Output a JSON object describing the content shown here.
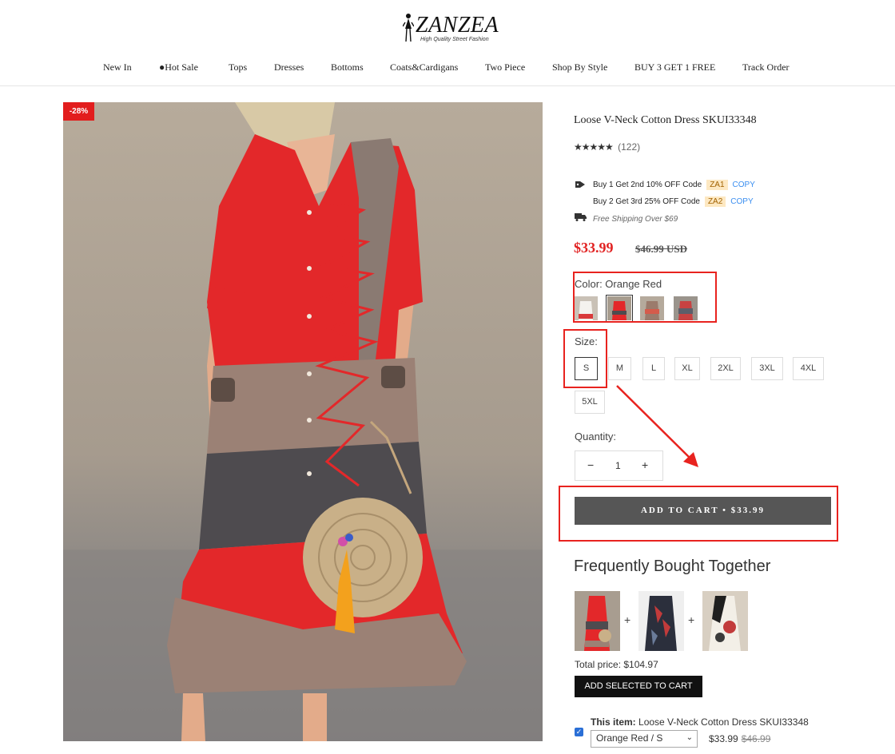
{
  "header": {
    "brand": "ZANZEA",
    "tagline": "High Quality Street Fashion",
    "nav": [
      "New In",
      "Hot Sale",
      "Tops",
      "Dresses",
      "Bottoms",
      "Coats&Cardigans",
      "Two Piece",
      "Shop By Style",
      "BUY 3 GET 1 FREE",
      "Track Order"
    ]
  },
  "product": {
    "discount_badge": "-28%",
    "title": "Loose V-Neck Cotton Dress SKUI33348",
    "stars": "★★★★★",
    "review_count": "(122)",
    "promos": [
      {
        "text": "Buy 1 Get 2nd 10% OFF Code",
        "code": "ZA1",
        "copy": "COPY"
      },
      {
        "text": "Buy 2 Get 3rd 25% OFF Code",
        "code": "ZA2",
        "copy": "COPY"
      }
    ],
    "shipping": "Free Shipping Over $69",
    "price": "$33.99",
    "old_price": "$46.99 USD",
    "color_label": "Color: Orange Red",
    "colors": [
      "White",
      "Orange Red",
      "Khaki",
      "Red Gray"
    ],
    "selected_color_index": 1,
    "size_label": "Size:",
    "sizes": [
      "S",
      "M",
      "L",
      "XL",
      "2XL",
      "3XL",
      "4XL",
      "5XL"
    ],
    "selected_size": "S",
    "quantity_label": "Quantity:",
    "quantity": "1",
    "qty_minus": "−",
    "qty_plus": "+",
    "add_to_cart": "ADD TO CART   •   $33.99"
  },
  "fbt": {
    "title": "Frequently Bought Together",
    "plus": "+",
    "total_price": "Total price: $104.97",
    "add_selected": "ADD SELECTED TO CART",
    "this_item_label": "This item:",
    "this_item_name": "Loose V-Neck Cotton Dress SKUI33348",
    "variant": "Orange Red / S",
    "item_price": "$33.99",
    "item_old_price": "$46.99"
  },
  "colors": {
    "accent_red": "#e12222",
    "highlight_box": "#e8231f",
    "button_gray": "#565656",
    "link_blue": "#3a8ef0"
  }
}
